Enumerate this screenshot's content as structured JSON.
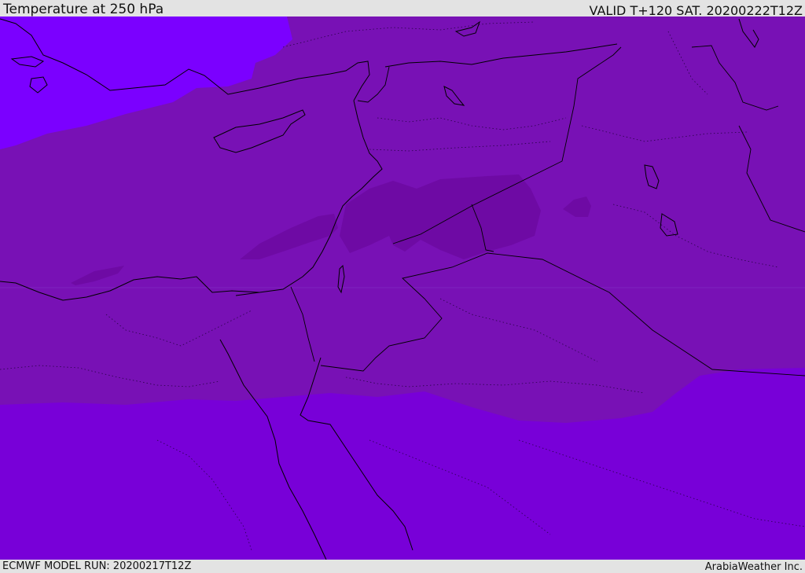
{
  "header": {
    "title": "Temperature at 250 hPa",
    "valid": "VALID T+120 SAT. 20200222T12Z"
  },
  "footer": {
    "model_run": "ECMWF MODEL RUN: 20200217T12Z",
    "credit": "ArabiaWeather Inc."
  },
  "map": {
    "colors": {
      "cold_band": "#7b00ff",
      "mid_band": "#7811b5",
      "warm_core": "#6e0aa4",
      "south_band": "#7800d8",
      "borders": "#000000"
    }
  }
}
